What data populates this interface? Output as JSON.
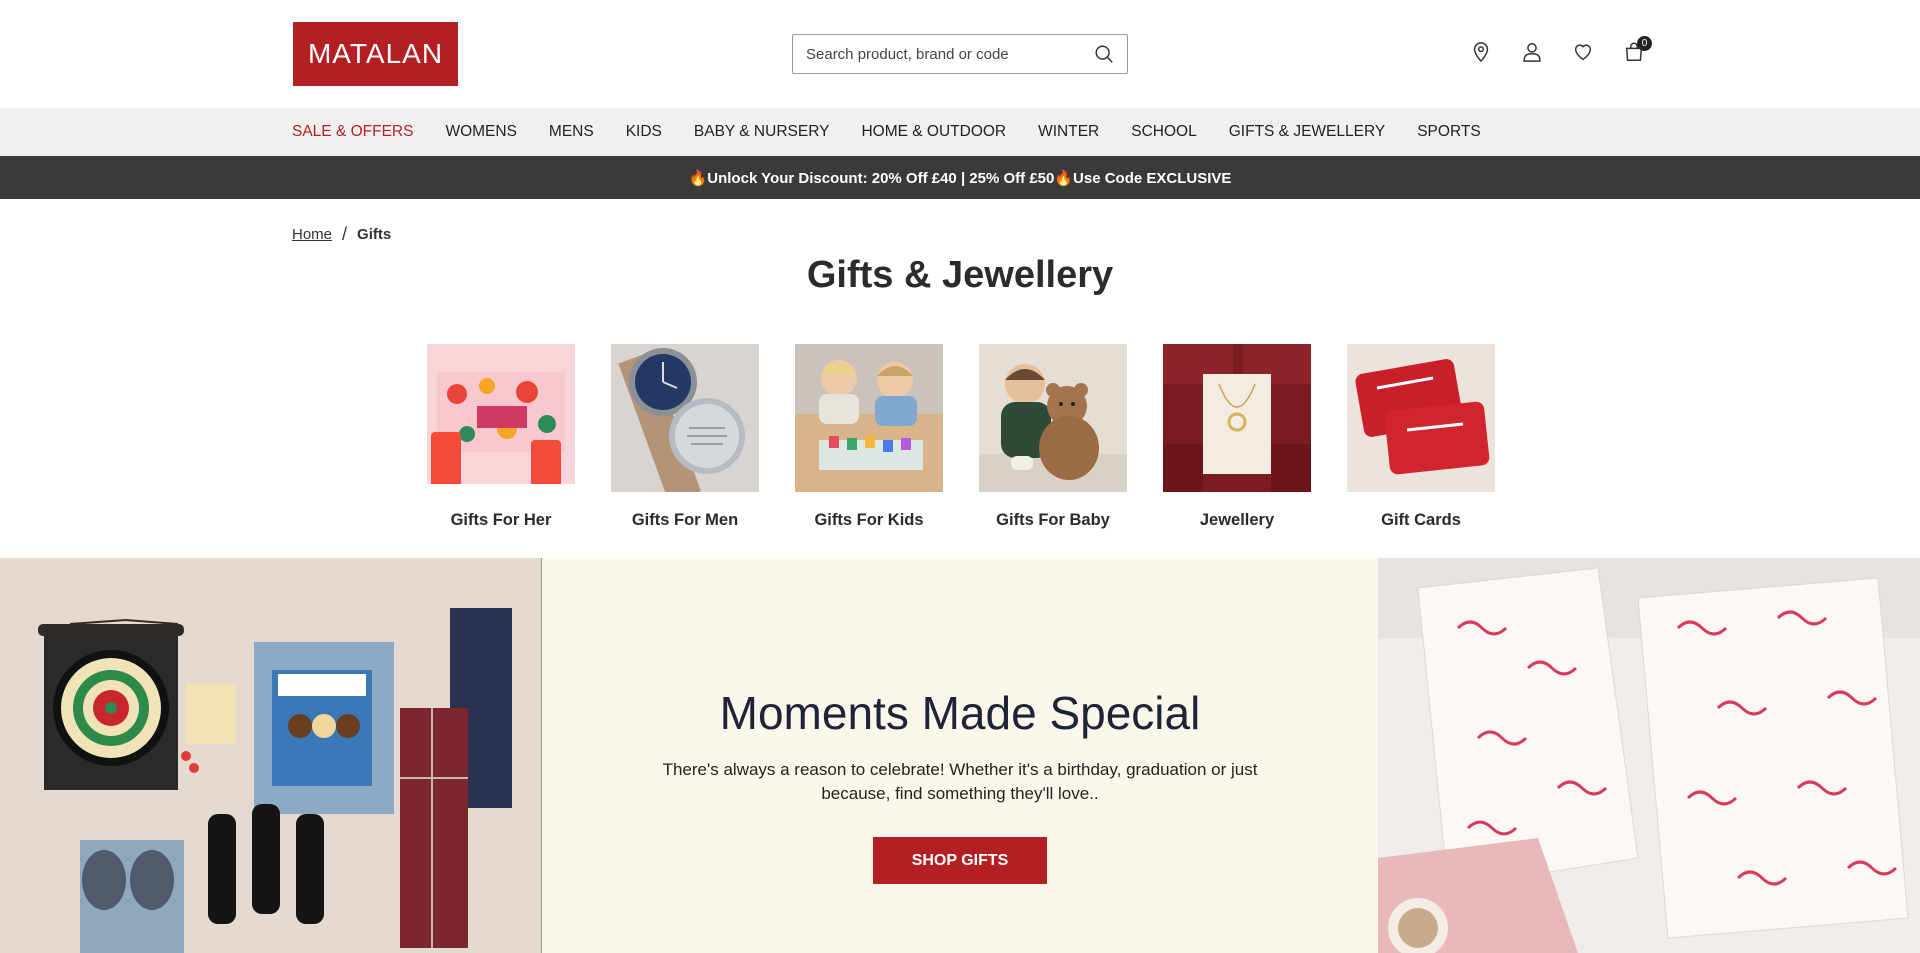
{
  "header": {
    "logo_text": "MATALAN",
    "search_placeholder": "Search product, brand or code",
    "bag_count": "0"
  },
  "nav": {
    "items": [
      {
        "label": "SALE & OFFERS"
      },
      {
        "label": "WOMENS"
      },
      {
        "label": "MENS"
      },
      {
        "label": "KIDS"
      },
      {
        "label": "BABY & NURSERY"
      },
      {
        "label": "HOME & OUTDOOR"
      },
      {
        "label": "WINTER"
      },
      {
        "label": "SCHOOL"
      },
      {
        "label": "GIFTS & JEWELLERY"
      },
      {
        "label": "SPORTS"
      }
    ]
  },
  "promo": {
    "text": "🔥Unlock Your Discount: 20% Off £40 | 25% Off £50🔥Use Code EXCLUSIVE"
  },
  "breadcrumb": {
    "home": "Home",
    "separator": "/",
    "current": "Gifts"
  },
  "page": {
    "title": "Gifts & Jewellery"
  },
  "categories": [
    {
      "label": "Gifts For Her"
    },
    {
      "label": "Gifts For Men"
    },
    {
      "label": "Gifts For Kids"
    },
    {
      "label": "Gifts For Baby"
    },
    {
      "label": "Jewellery"
    },
    {
      "label": "Gift Cards"
    }
  ],
  "hero": {
    "title": "Moments Made Special",
    "text": "There's always a reason to celebrate! Whether it's a birthday, graduation or just because, find something they'll love..",
    "button": "SHOP GIFTS"
  },
  "colors": {
    "brand": "#b41f24",
    "promo_bar": "#3a3a3a",
    "nav_bg": "#f0f0f0",
    "hero_bg": "#fbf7ea"
  }
}
